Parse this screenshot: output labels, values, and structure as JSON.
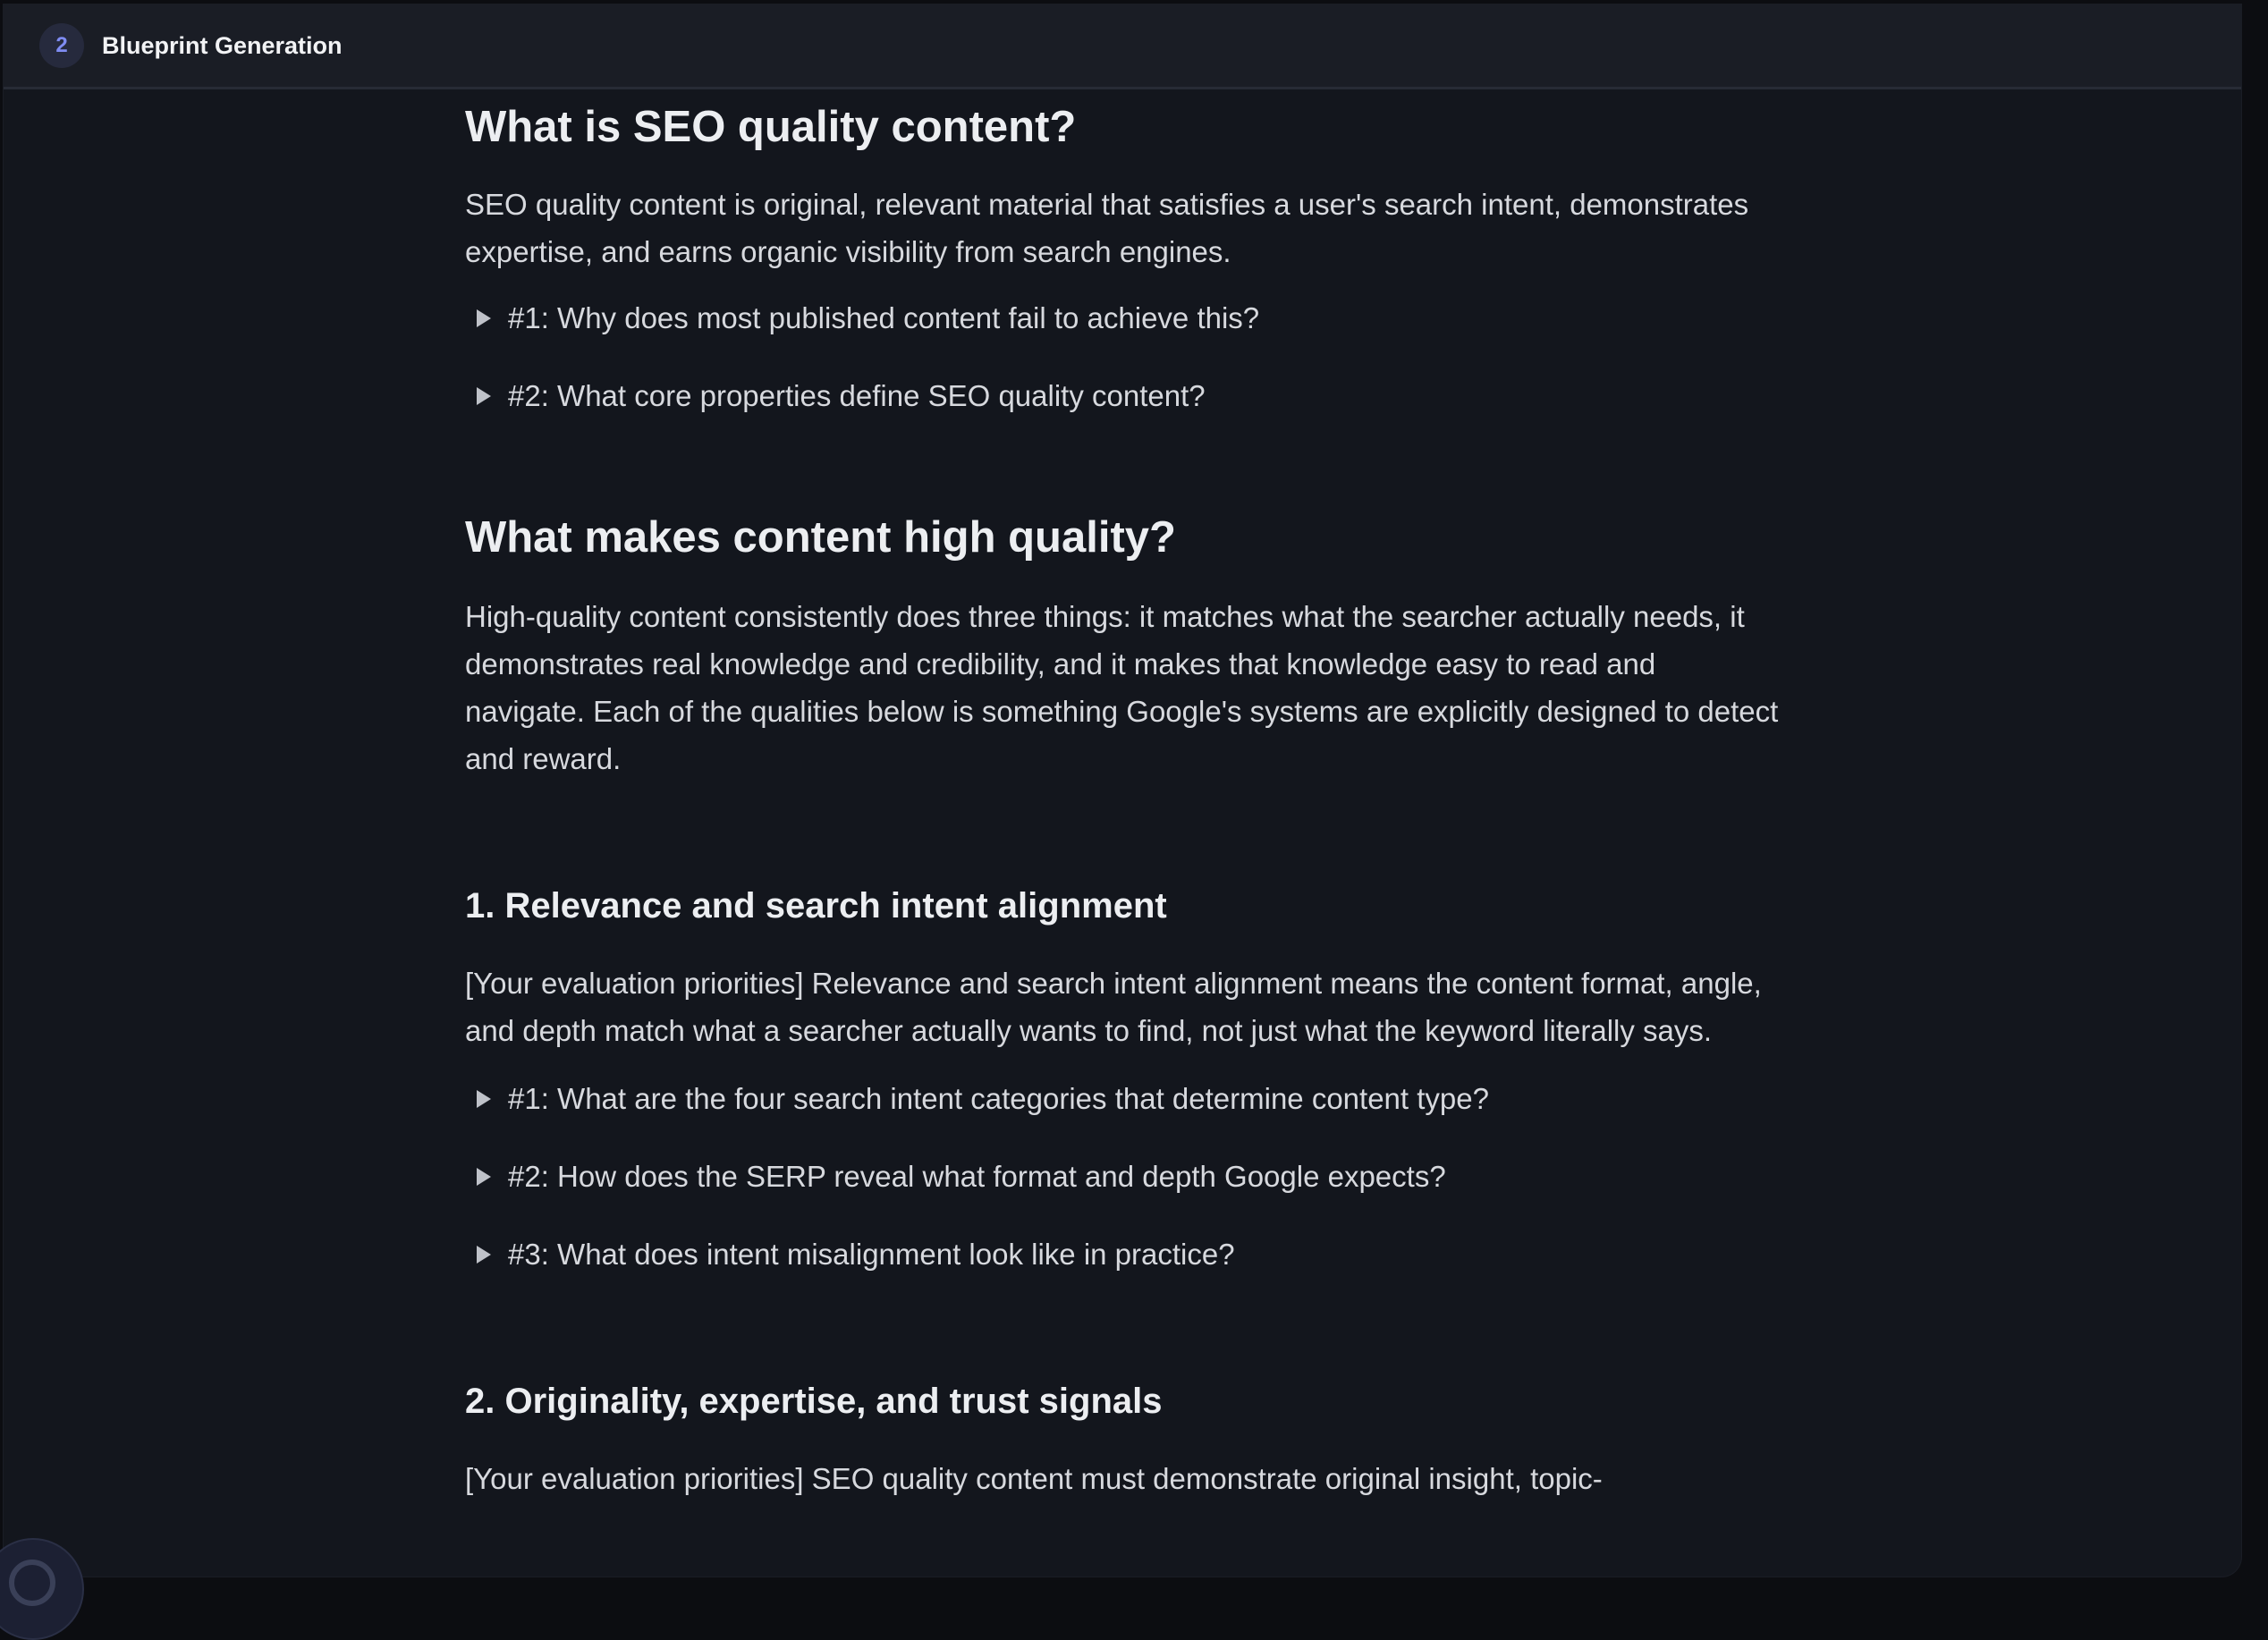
{
  "header": {
    "step_number": "2",
    "title": "Blueprint Generation"
  },
  "sections": {
    "s1": {
      "heading": "What is SEO quality content?",
      "body": "SEO quality content is original, relevant material that satisfies a user's search intent, demonstrates expertise, and earns organic visibility from search engines.",
      "faqs": [
        "#1: Why does most published content fail to achieve this?",
        "#2: What core properties define SEO quality content?"
      ]
    },
    "s2": {
      "heading": "What makes content high quality?",
      "body": "High-quality content consistently does three things: it matches what the searcher actually needs, it demonstrates real knowledge and credibility, and it makes that knowledge easy to read and navigate. Each of the qualities below is something Google's systems are explicitly designed to detect and reward."
    },
    "s3": {
      "heading": "1. Relevance and search intent alignment",
      "body": "[Your evaluation priorities] Relevance and search intent alignment means the content format, angle, and depth match what a searcher actually wants to find, not just what the keyword literally says.",
      "faqs": [
        "#1: What are the four search intent categories that determine content type?",
        "#2: How does the SERP reveal what format and depth Google expects?",
        "#3: What does intent misalignment look like in practice?"
      ]
    },
    "s4": {
      "heading": "2. Originality, expertise, and trust signals",
      "body": "[Your evaluation priorities] SEO quality content must demonstrate original insight, topic-"
    }
  },
  "icons": {
    "faq_toggle": "triangle-right-icon",
    "corner": "app-logo-icon"
  },
  "colors": {
    "background": "#13161d",
    "topbar": "#1a1d25",
    "accent": "#7f8cf2",
    "text": "#d7d9de"
  }
}
